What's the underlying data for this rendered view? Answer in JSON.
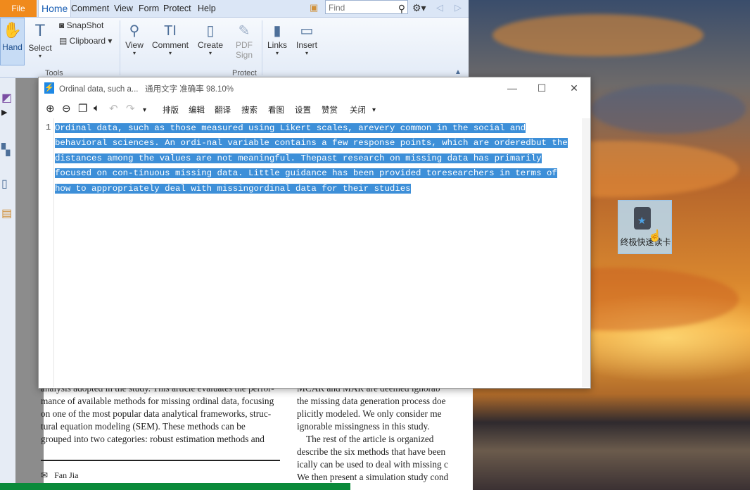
{
  "app": {
    "menu": {
      "file": "File",
      "home": "Home",
      "items": [
        "Comment",
        "View",
        "Form",
        "Protect",
        "Help"
      ],
      "find_placeholder": "Find"
    },
    "ribbon": {
      "hand": "Hand",
      "select": "Select",
      "snapshot": "SnapShot",
      "clipboard": "Clipboard",
      "view": "View",
      "comment": "Comment",
      "create": "Create",
      "pdf_sign_1": "PDF",
      "pdf_sign_2": "Sign",
      "links": "Links",
      "insert": "Insert",
      "group_tools": "Tools",
      "group_protect": "Protect"
    },
    "document": {
      "left_lines": [
        "analysis adopted in the study. This article evaluates the perfor-",
        "mance of available methods for missing ordinal data, focusing",
        "on one of the most popular data analytical frameworks, struc-",
        "tural equation modeling (SEM). These methods can be",
        "grouped into two categories: robust estimation methods and"
      ],
      "right_lines": [
        "MCAR and MAR are deemed ignorab",
        "the missing data generation process doe",
        "plicitly modeled. We only consider me",
        "ignorable missingness in this study.",
        "    The rest of the article is organized",
        "describe the six methods that have been",
        "ically can be used to deal with missing c",
        "We then present a simulation study cond"
      ],
      "author": "Fan Jia"
    }
  },
  "ocr_window": {
    "title": "Ordinal data, such a...",
    "subtitle": "通用文字 准确率 98.10%",
    "commands": [
      "排版",
      "编辑",
      "翻译",
      "搜索",
      "看图",
      "设置",
      "赞赏",
      "关闭"
    ],
    "line_number": "1",
    "text_lines": [
      "Ordinal data, such as those measured using Likert scales, arevery common in the social and",
      "behavioral sciences. An ordi-nal variable contains a few response points, which are orderedbut the",
      "distances among the values are not meaningful. Thepast research on missing data has primarily",
      "focused on con-tinuous missing data. Little guidance has been provided toresearchers in terms of",
      "how to appropriately deal with missingordinal data for their studies"
    ]
  },
  "desktop": {
    "shortcut_label": "终极快速读卡"
  },
  "colors": {
    "selection": "#3d8fd8",
    "file_tab": "#f08a1c",
    "home_tab_text": "#1a5fb4"
  }
}
